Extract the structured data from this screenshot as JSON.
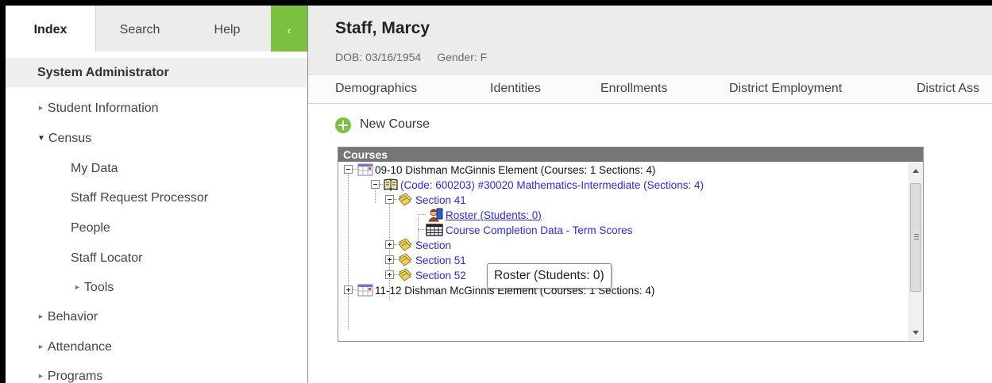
{
  "sidebar": {
    "tabs": [
      {
        "label": "Index"
      },
      {
        "label": "Search"
      },
      {
        "label": "Help"
      }
    ],
    "collapse_glyph": "‹",
    "section_title": "System Administrator",
    "items": [
      {
        "label": "Student Information",
        "state": "collapsed"
      },
      {
        "label": "Census",
        "state": "expanded"
      },
      {
        "label": "My Data"
      },
      {
        "label": "Staff Request Processor"
      },
      {
        "label": "People"
      },
      {
        "label": "Staff Locator"
      },
      {
        "label": "Tools",
        "state": "collapsed"
      },
      {
        "label": "Behavior",
        "state": "collapsed"
      },
      {
        "label": "Attendance",
        "state": "collapsed"
      },
      {
        "label": "Programs",
        "state": "collapsed"
      }
    ],
    "caret_collapsed": "►",
    "caret_expanded": "▼"
  },
  "person": {
    "name": "Staff, Marcy",
    "dob": "DOB: 03/16/1954",
    "gender": "Gender: F"
  },
  "main_tabs": [
    {
      "label": "Demographics"
    },
    {
      "label": "Identities"
    },
    {
      "label": "Enrollments"
    },
    {
      "label": "District Employment"
    },
    {
      "label": "District Ass"
    }
  ],
  "new_course": {
    "label": "New Course",
    "icon": "plus-circle-icon"
  },
  "courses_panel": {
    "title": "Courses",
    "tree": [
      {
        "label": "09-10 Dishman McGinnis Element (Courses: 1 Sections: 4)",
        "icon": "calendar-icon",
        "toggle": "minus"
      },
      {
        "label": "(Code: 600203) #30020 Mathematics-Intermediate (Sections: 4)",
        "icon": "book-icon",
        "toggle": "minus"
      },
      {
        "label": "Section 41",
        "icon": "section-icon",
        "toggle": "minus"
      },
      {
        "label": "Roster (Students: 0)",
        "icon": "roster-icon"
      },
      {
        "label": "Course Completion Data - Term Scores",
        "icon": "grid-icon"
      },
      {
        "label": "Section",
        "icon": "section-icon",
        "toggle": "plus"
      },
      {
        "label": "Section 51",
        "icon": "section-icon",
        "toggle": "plus"
      },
      {
        "label": "Section 52",
        "icon": "section-icon",
        "toggle": "plus"
      },
      {
        "label": "11-12 Dishman McGinnis Element (Courses: 1 Sections: 4)",
        "icon": "calendar-icon",
        "toggle": "plus"
      }
    ]
  },
  "tooltip": {
    "text": "Roster (Students: 0)"
  },
  "colors": {
    "accent_green": "#7cc142",
    "link_blue": "#2b2bdc",
    "panel_header": "#767676"
  }
}
